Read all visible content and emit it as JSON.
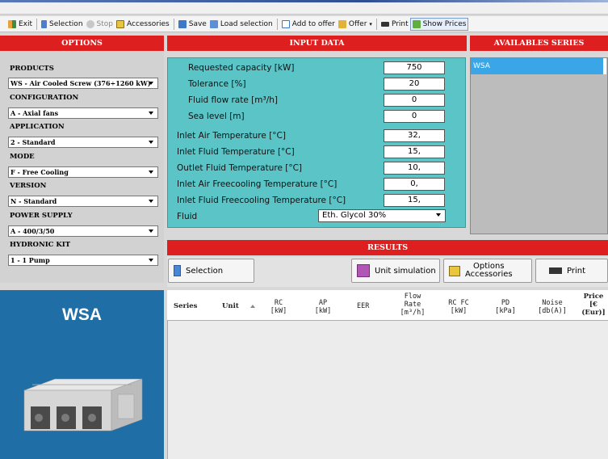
{
  "toolbar": {
    "exit": "Exit",
    "selection": "Selection",
    "stop": "Stop",
    "accessories": "Accessories",
    "save": "Save",
    "load_selection": "Load selection",
    "add_to_offer": "Add to offer",
    "offer": "Offer",
    "print": "Print",
    "show_prices": "Show Prices"
  },
  "headers": {
    "options": "OPTIONS",
    "input_data": "INPUT DATA",
    "available_series": "AVAILABLES SERIES",
    "results": "RESULTS"
  },
  "options": {
    "products_label": "PRODUCTS",
    "products_value": "WS - Air Cooled Screw (376÷1260 kW)",
    "configuration_label": "CONFIGURATION",
    "configuration_value": "A - Axial fans",
    "application_label": "APPLICATION",
    "application_value": "2 - Standard",
    "mode_label": "MODE",
    "mode_value": "F - Free Cooling",
    "version_label": "VERSION",
    "version_value": "N - Standard",
    "power_supply_label": "POWER SUPPLY",
    "power_supply_value": "A - 400/3/50",
    "hydronic_kit_label": "HYDRONIC KIT",
    "hydronic_kit_value": "1 - 1 Pump"
  },
  "inputs": {
    "requested_capacity_label": "Requested capacity [kW]",
    "requested_capacity_value": "750",
    "tolerance_label": "Tolerance [%]",
    "tolerance_value": "20",
    "fluid_flow_label": "Fluid flow rate [m³/h]",
    "fluid_flow_value": "0",
    "sea_level_label": "Sea level [m]",
    "sea_level_value": "0",
    "inlet_air_temp_label": "Inlet Air Temperature [°C]",
    "inlet_air_temp_value": "32,",
    "inlet_fluid_temp_label": "Inlet Fluid Temperature [°C]",
    "inlet_fluid_temp_value": "15,",
    "outlet_fluid_temp_label": "Outlet Fluid Temperature [°C]",
    "outlet_fluid_temp_value": "10,",
    "inlet_air_fc_label": "Inlet Air Freecooling Temperature [°C]",
    "inlet_air_fc_value": "0,",
    "inlet_fluid_fc_label": "Inlet Fluid Freecooling Temperature [°C]",
    "inlet_fluid_fc_value": "15,",
    "fluid_label": "Fluid",
    "fluid_value": "Eth. Glycol 30%"
  },
  "series": {
    "items": [
      "WSA"
    ]
  },
  "results": {
    "selection_btn": "Selection",
    "unit_sim_btn": "Unit simulation",
    "options_btn_line1": "Options",
    "options_btn_line2": "Accessories",
    "print_btn": "Print"
  },
  "table": {
    "columns": [
      "Series",
      "Unit",
      "RC [kW]",
      "AP [kW]",
      "EER",
      "Flow Rate [m³/h]",
      "RC FC [kW]",
      "PD [kPa]",
      "Noise [db(A)]",
      "Price [€ (Eur)]"
    ]
  },
  "product_panel": {
    "title": "WSA"
  },
  "colors": {
    "header_red": "#dd1f1f",
    "input_teal": "#5bc4c7",
    "series_blue": "#3aa6e8",
    "product_blue": "#1f6fa6"
  }
}
